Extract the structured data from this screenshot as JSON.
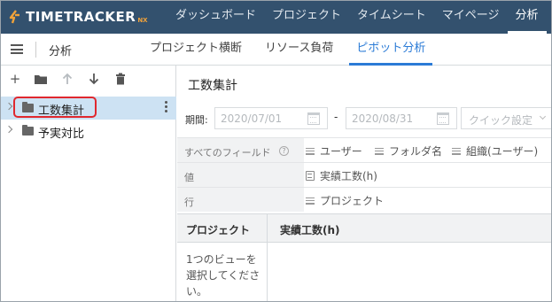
{
  "app": {
    "logo_text": "TIMETRACKER",
    "logo_suffix": "NX"
  },
  "nav": {
    "items": [
      {
        "label": "ダッシュボード"
      },
      {
        "label": "プロジェクト"
      },
      {
        "label": "タイムシート"
      },
      {
        "label": "マイページ"
      },
      {
        "label": "分析"
      }
    ],
    "active": "分析"
  },
  "subbar": {
    "title": "分析",
    "tabs": [
      {
        "label": "プロジェクト横断"
      },
      {
        "label": "リソース負荷"
      },
      {
        "label": "ピボット分析"
      }
    ],
    "active_tab": "ピボット分析"
  },
  "sidebar": {
    "toolbar": [
      "add-icon",
      "folder-icon",
      "arrow-up-icon",
      "arrow-down-icon",
      "trash-icon"
    ],
    "items": [
      {
        "label": "工数集計",
        "selected": true
      },
      {
        "label": "予実対比",
        "selected": false
      }
    ]
  },
  "main": {
    "title": "工数集計",
    "period_label": "期間:",
    "date_from": "2020/07/01",
    "date_separator": "-",
    "date_to": "2020/08/31",
    "quick_setting": "クイック設定",
    "all_fields_label": "すべてのフィールド",
    "help_icon": "?",
    "all_fields": [
      "ユーザー",
      "フォルダ名",
      "組織(ユーザー)"
    ],
    "values_label": "値",
    "values": [
      "実績工数(h)"
    ],
    "rows_label": "行",
    "rows": [
      "プロジェクト"
    ],
    "table": {
      "col1": "プロジェクト",
      "col2": "実績工数(h)",
      "empty_message": "1つのビューを選択してください。"
    }
  },
  "colors": {
    "topbar": "#33516e",
    "accent": "#2b7bd6",
    "selected_row": "#cde2f3",
    "highlight_border": "#e0282e"
  }
}
